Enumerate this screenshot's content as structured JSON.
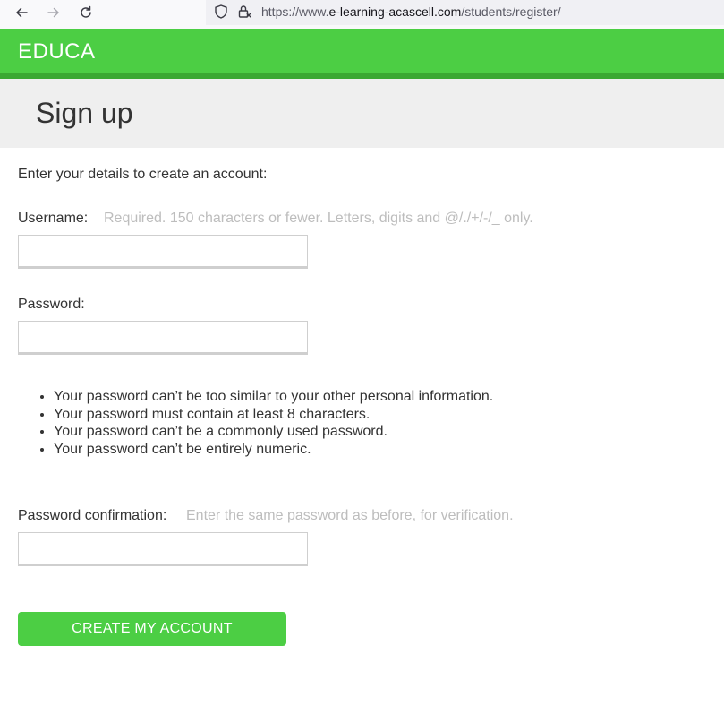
{
  "browser": {
    "url_prefix": "https://www.",
    "url_domain": "e-learning-acascell.com",
    "url_path": "/students/register/"
  },
  "icons": {
    "back": "arrow-left-icon",
    "forward": "arrow-right-icon",
    "reload": "reload-icon",
    "tracking": "shield-icon",
    "lock": "lock-icon"
  },
  "site": {
    "logo": "EDUCA",
    "accent_color": "#4cce44"
  },
  "page": {
    "title": "Sign up",
    "intro": "Enter your details to create an account:"
  },
  "form": {
    "username_label": "Username:",
    "username_help": "Required. 150 characters or fewer. Letters, digits and @/./+/-/_ only.",
    "username_value": "",
    "password_label": "Password:",
    "password_value": "",
    "password_rules": [
      "Your password can’t be too similar to your other personal information.",
      "Your password must contain at least 8 characters.",
      "Your password can’t be a commonly used password.",
      "Your password can’t be entirely numeric."
    ],
    "confirm_label": "Password confirmation:",
    "confirm_help": "Enter the same password as before, for verification.",
    "confirm_value": "",
    "submit_label": "CREATE MY ACCOUNT"
  }
}
